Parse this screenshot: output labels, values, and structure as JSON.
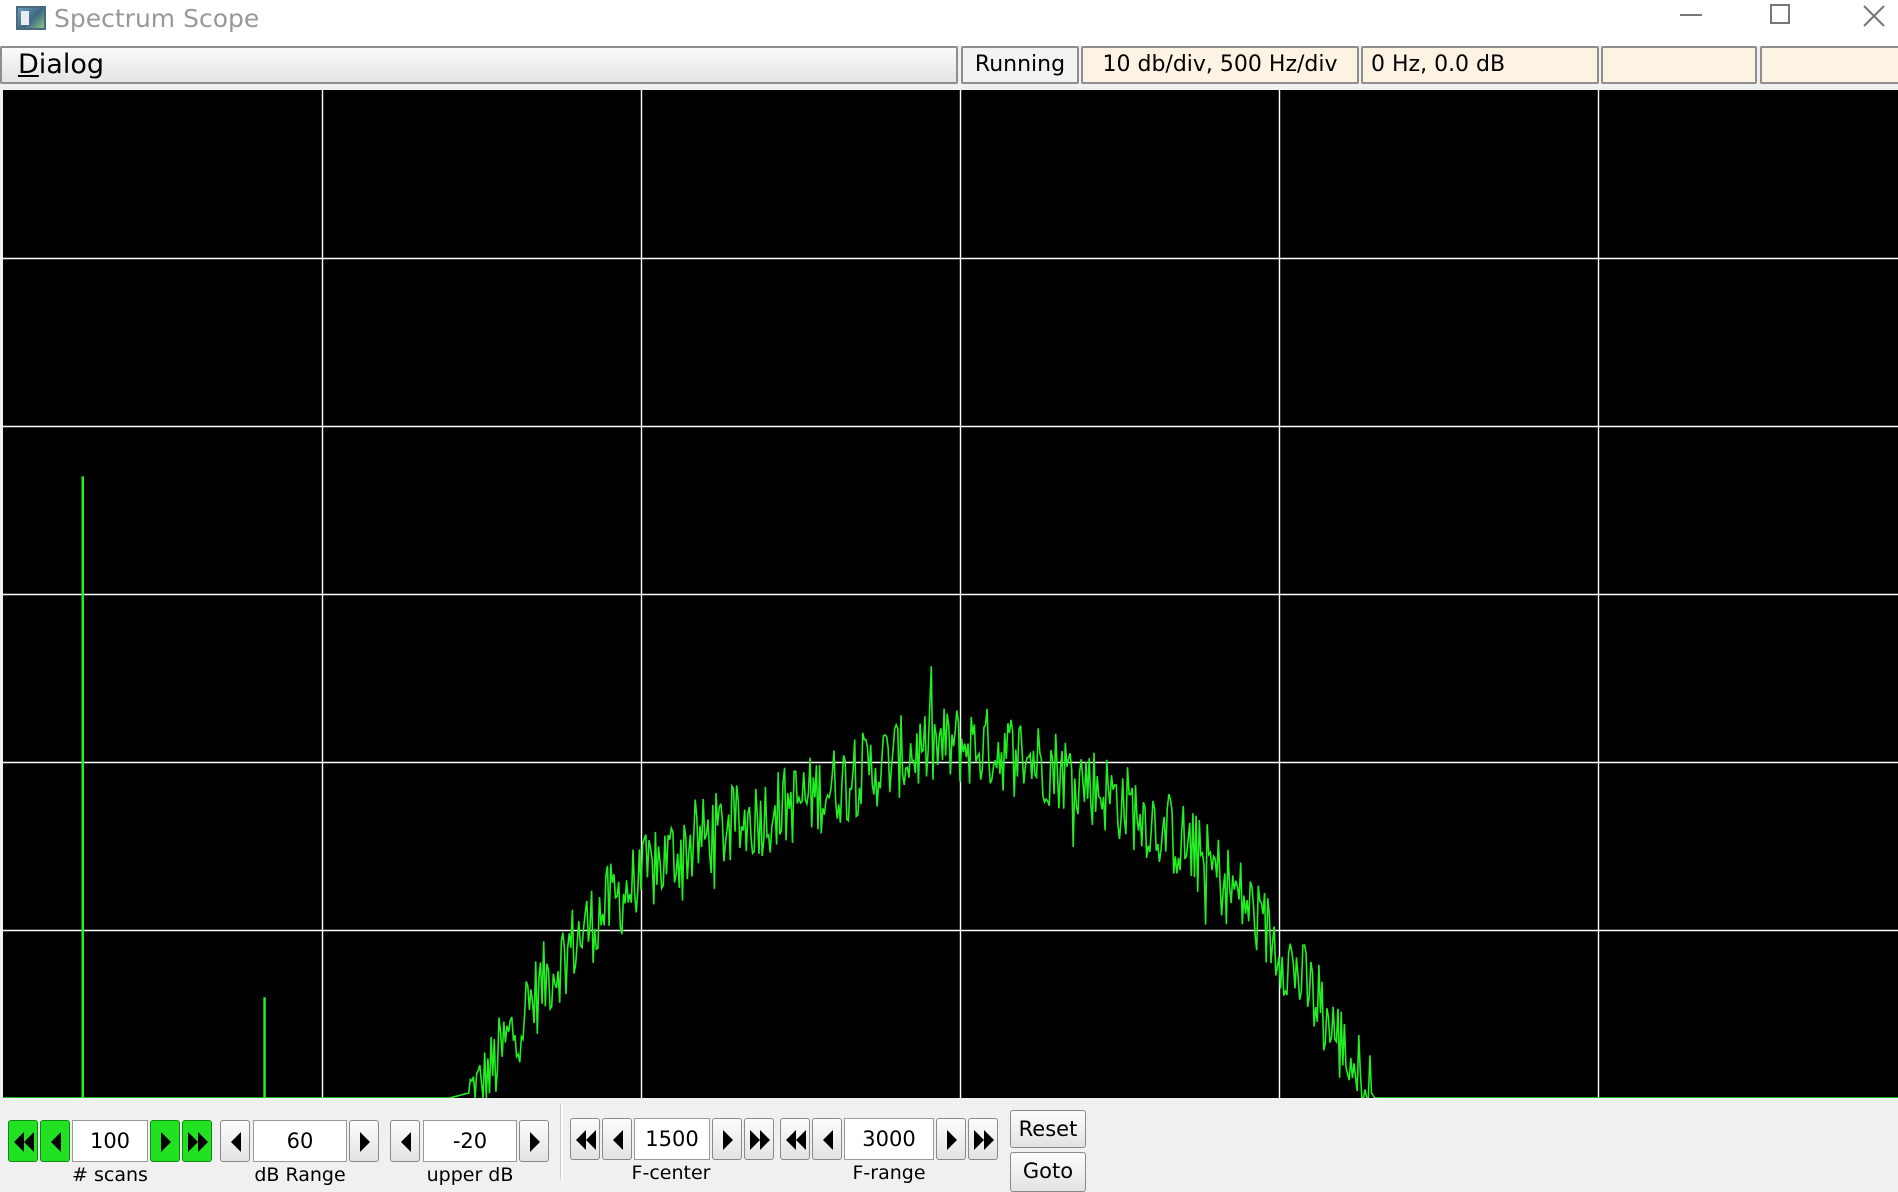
{
  "window": {
    "title": "Spectrum Scope",
    "minimize_icon": "minimize-icon",
    "maximize_icon": "maximize-icon",
    "close_icon": "close-icon"
  },
  "statusbar": {
    "dialog_label_first": "D",
    "dialog_label_rest": "ialog",
    "running": "Running",
    "scale": "10 db/div, 500 Hz/div",
    "cursor": "0 Hz, 0.0 dB",
    "extra1": "",
    "extra2": ""
  },
  "scope": {
    "trace_color": "#22ee22",
    "grid_color": "#ffffff",
    "background": "#000000"
  },
  "controls": {
    "scans": {
      "value": "100",
      "label": "# scans"
    },
    "db_range": {
      "value": "60",
      "label": "dB Range"
    },
    "upper_db": {
      "value": "-20",
      "label": "upper dB"
    },
    "f_center": {
      "value": "1500",
      "label": "F-center"
    },
    "f_range": {
      "value": "3000",
      "label": "F-range"
    },
    "reset_label": "Reset",
    "goto_label": "Goto"
  },
  "chart_data": {
    "type": "line",
    "title": "",
    "xlabel": "",
    "ylabel": "",
    "x_unit": "Hz",
    "xlim": [
      0,
      3000
    ],
    "ylim": [
      -80,
      -20
    ],
    "grid": true,
    "series": [
      {
        "x": [
          0,
          50,
          100,
          150,
          200,
          250,
          300,
          350,
          400,
          450,
          500,
          550,
          600,
          650,
          700,
          750,
          800,
          850,
          900,
          950,
          1000,
          1050,
          1100,
          1150,
          1200,
          1250,
          1300,
          1350,
          1400,
          1450,
          1500,
          1550,
          1600,
          1650,
          1700,
          1750,
          1800,
          1850,
          1900,
          1950,
          2000,
          2050,
          2100,
          2150,
          2200,
          2250,
          2300,
          2350,
          2400,
          2450,
          2500,
          2550,
          2600,
          2650,
          2700,
          2750,
          2800,
          2850,
          2900,
          2950,
          3000
        ],
        "y": [
          -80,
          -80,
          -80,
          -80,
          -80,
          -80,
          -80,
          -80,
          -80,
          -80,
          -80,
          -80,
          -80,
          -80,
          -80,
          -79.5,
          -76,
          -73,
          -70.5,
          -68.5,
          -67,
          -65.5,
          -64.5,
          -63.8,
          -63,
          -62.3,
          -61.5,
          -60.6,
          -59.8,
          -59.2,
          -59,
          -59.2,
          -59.6,
          -60.3,
          -61.2,
          -62.3,
          -63.5,
          -64.8,
          -66.5,
          -68.5,
          -71,
          -73.8,
          -77,
          -80,
          -80,
          -80,
          -80,
          -80,
          -80,
          -80,
          -80,
          -80,
          -80,
          -80,
          -80,
          -80,
          -80,
          -80,
          -80,
          -80,
          -80
        ]
      }
    ],
    "spikes": [
      {
        "x": 125,
        "y": -43
      },
      {
        "x": 410,
        "y": -74
      }
    ]
  }
}
